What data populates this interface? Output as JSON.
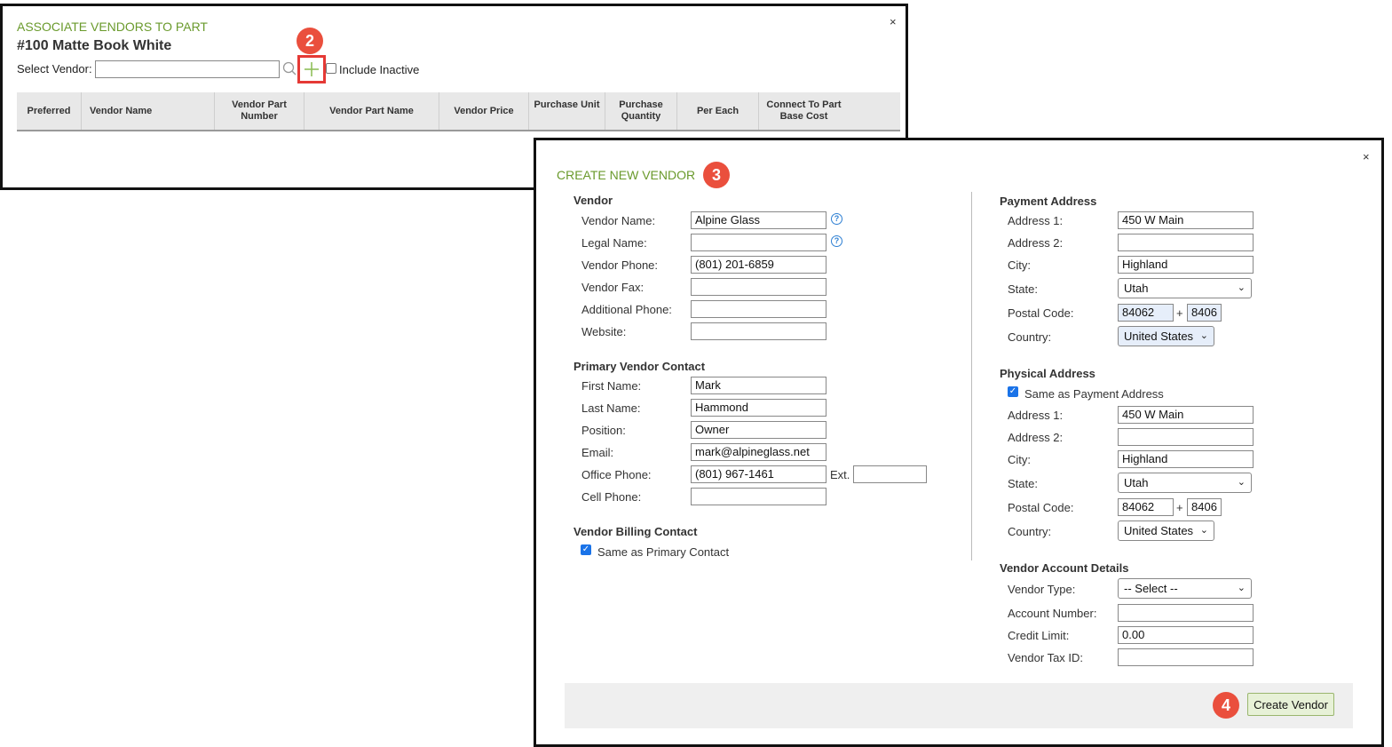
{
  "associate_dialog": {
    "title": "ASSOCIATE VENDORS TO PART",
    "part_name": "#100 Matte Book White",
    "select_vendor_label": "Select Vendor:",
    "select_vendor_value": "",
    "include_inactive_label": "Include Inactive",
    "close_label": "×",
    "columns": [
      "Preferred",
      "Vendor Name",
      "Vendor Part Number",
      "Vendor Part Name",
      "Vendor Price",
      "Purchase Unit",
      "Purchase Quantity",
      "Per Each",
      "Connect To Part Base Cost"
    ],
    "step_badge": "2",
    "icons": {
      "search": "search-icon",
      "add": "plus-icon"
    }
  },
  "create_vendor_dialog": {
    "title": "CREATE NEW VENDOR",
    "step_badge": "3",
    "close_label": "×",
    "vendor": {
      "heading": "Vendor",
      "vendor_name_label": "Vendor Name:",
      "vendor_name": "Alpine Glass",
      "legal_name_label": "Legal Name:",
      "legal_name": "",
      "vendor_phone_label": "Vendor Phone:",
      "vendor_phone": "(801) 201-6859",
      "vendor_fax_label": "Vendor Fax:",
      "vendor_fax": "",
      "additional_phone_label": "Additional Phone:",
      "additional_phone": "",
      "website_label": "Website:",
      "website": ""
    },
    "primary_contact": {
      "heading": "Primary Vendor Contact",
      "first_name_label": "First Name:",
      "first_name": "Mark",
      "last_name_label": "Last Name:",
      "last_name": "Hammond",
      "position_label": "Position:",
      "position": "Owner",
      "email_label": "Email:",
      "email": "mark@alpineglass.net",
      "office_phone_label": "Office Phone:",
      "office_phone": "(801) 967-1461",
      "ext_label": "Ext.",
      "ext": "",
      "cell_phone_label": "Cell Phone:",
      "cell_phone": ""
    },
    "billing_contact": {
      "heading": "Vendor Billing Contact",
      "same_as_primary_label": "Same as Primary Contact",
      "same_as_primary_checked": true
    },
    "payment_address": {
      "heading": "Payment Address",
      "address1_label": "Address 1:",
      "address1": "450 W Main",
      "address2_label": "Address 2:",
      "address2": "",
      "city_label": "City:",
      "city": "Highland",
      "state_label": "State:",
      "state": "Utah",
      "postal_label": "Postal Code:",
      "postal": "84062",
      "plus": "+",
      "postal_ext": "8406",
      "country_label": "Country:",
      "country": "United States"
    },
    "physical_address": {
      "heading": "Physical Address",
      "same_as_payment_label": "Same as Payment Address",
      "same_as_payment_checked": true,
      "address1_label": "Address 1:",
      "address1": "450 W Main",
      "address2_label": "Address 2:",
      "address2": "",
      "city_label": "City:",
      "city": "Highland",
      "state_label": "State:",
      "state": "Utah",
      "postal_label": "Postal Code:",
      "postal": "84062",
      "plus": "+",
      "postal_ext": "8406",
      "country_label": "Country:",
      "country": "United States"
    },
    "account_details": {
      "heading": "Vendor Account Details",
      "vendor_type_label": "Vendor Type:",
      "vendor_type": "-- Select --",
      "account_number_label": "Account Number:",
      "account_number": "",
      "credit_limit_label": "Credit Limit:",
      "credit_limit": "0.00",
      "tax_id_label": "Vendor Tax ID:",
      "tax_id": ""
    },
    "footer": {
      "create_button_label": "Create Vendor",
      "step_badge": "4"
    }
  },
  "colors": {
    "title_green": "#6a9a2c",
    "badge_red": "#ea4f3d",
    "highlight_red": "#e53935",
    "button_bg": "#e7f1d7",
    "footer_bg": "#efefef"
  }
}
